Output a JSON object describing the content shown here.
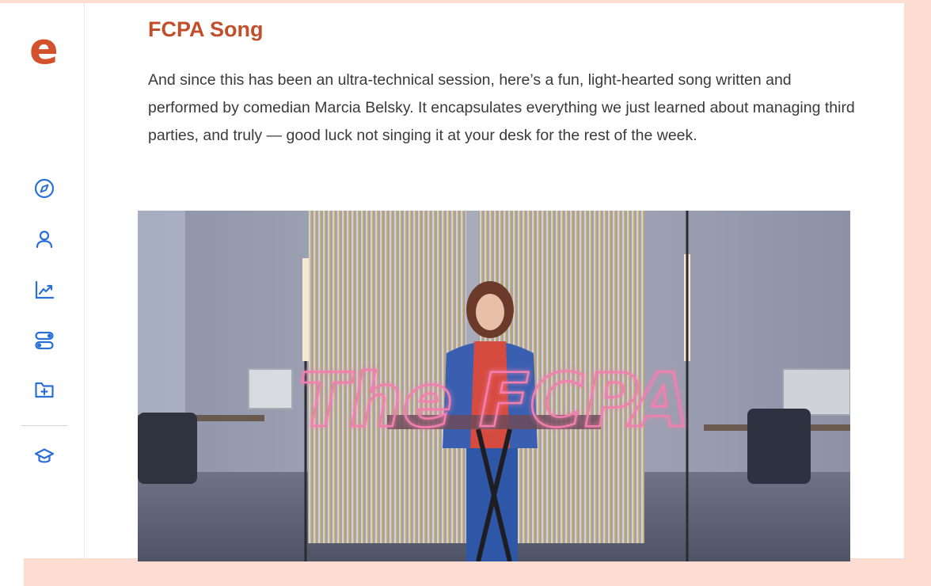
{
  "sidebar": {
    "logo": "e",
    "brand_color": "#d2512c",
    "icon_color": "#2a6fd6",
    "items": [
      {
        "icon": "compass-icon"
      },
      {
        "icon": "user-icon"
      },
      {
        "icon": "analytics-trend-icon"
      },
      {
        "icon": "toggles-icon"
      },
      {
        "icon": "folder-add-icon"
      },
      {
        "icon": "graduation-cap-icon"
      }
    ]
  },
  "lesson": {
    "title": "FCPA Song",
    "paragraph": "And since this has been an ultra-technical session, here’s a fun, light-hearted song written and performed by comedian Marcia Belsky. It encapsulates everything we just learned about managing third parties, and truly — good luck not singing it at your desk for the rest of the week.",
    "title_color": "#c24e2c"
  },
  "video": {
    "overlay_text": "The FCPA",
    "neon_color": "#f27fae"
  },
  "theme": {
    "backdrop": "#fddcd1"
  }
}
